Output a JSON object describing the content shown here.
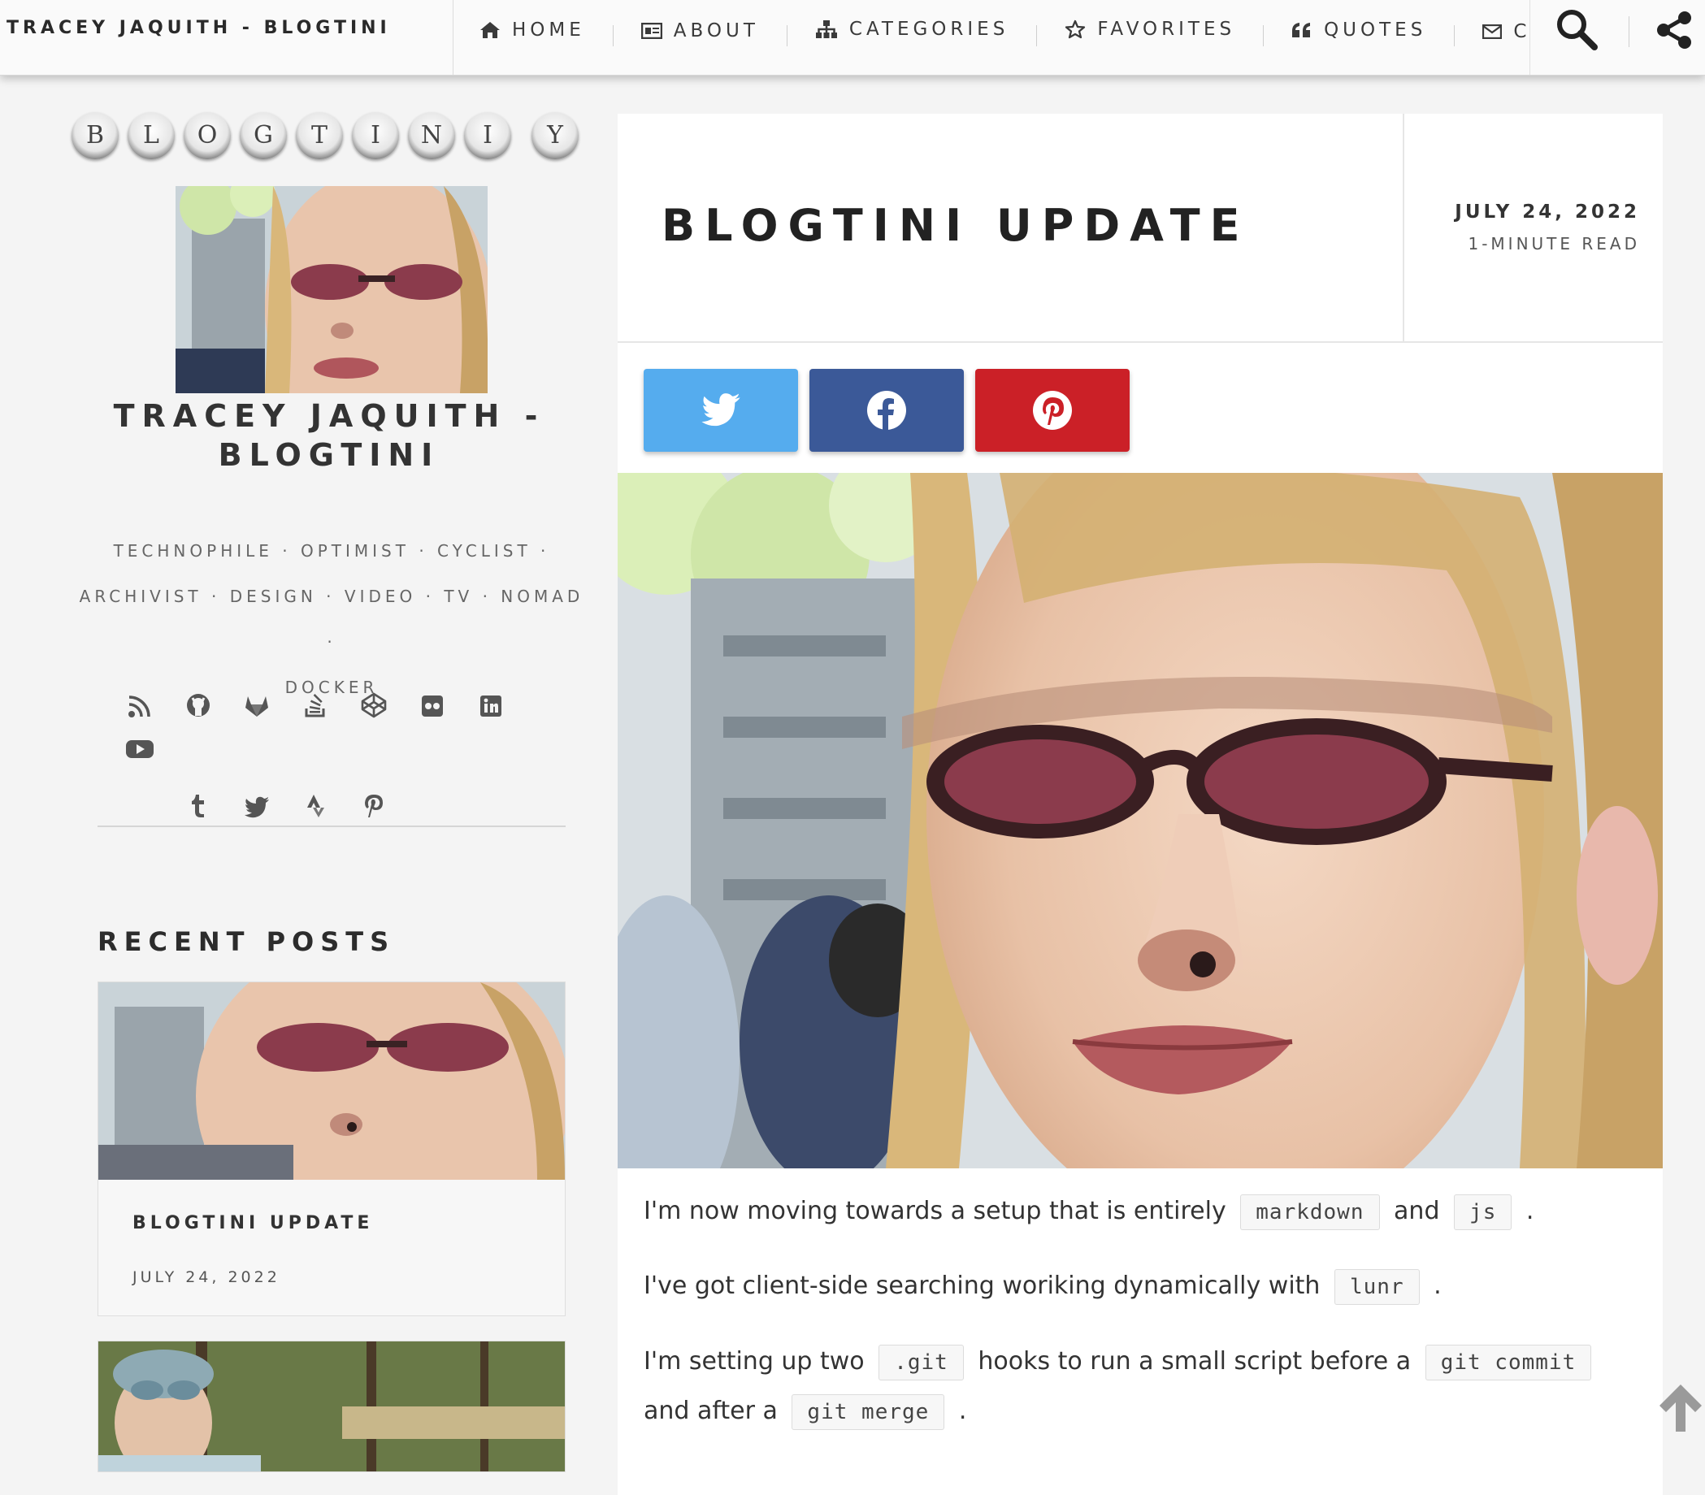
{
  "header": {
    "site_title": "TRACEY JAQUITH - BLOGTINI",
    "nav": [
      {
        "label": "HOME",
        "icon": "home-icon"
      },
      {
        "label": "ABOUT",
        "icon": "id-card-icon"
      },
      {
        "label": "CATEGORIES",
        "icon": "sitemap-icon"
      },
      {
        "label": "FAVORITES",
        "icon": "star-icon"
      },
      {
        "label": "QUOTES",
        "icon": "quote-icon"
      },
      {
        "label": "C",
        "icon": "envelope-icon"
      }
    ],
    "search_icon": "search-icon",
    "share_icon": "share-icon"
  },
  "sidebar": {
    "logo_letters": [
      "B",
      "L",
      "O",
      "G",
      "T",
      "I",
      "N",
      "I",
      "Y"
    ],
    "author_name_line1": "TRACEY JAQUITH -",
    "author_name_line2": "BLOGTINI",
    "bio_line1": "TECHNOPHILE · OPTIMIST · CYCLIST ·",
    "bio_line2": "ARCHIVIST · DESIGN · VIDEO · TV · NOMAD ·",
    "bio_line3": "DOCKER",
    "social_icons": [
      "rss-icon",
      "github-icon",
      "gitlab-icon",
      "stack-overflow-icon",
      "codepen-icon",
      "flickr-icon",
      "linkedin-icon",
      "youtube-icon",
      "tumblr-icon",
      "twitter-icon",
      "strava-icon",
      "pinterest-icon"
    ],
    "recent_posts_title": "RECENT POSTS",
    "recent_posts": [
      {
        "title": "BLOGTINI UPDATE",
        "date": "JULY 24, 2022"
      }
    ]
  },
  "article": {
    "title": "BLOGTINI UPDATE",
    "date": "JULY 24, 2022",
    "read_time": "1-MINUTE READ",
    "share_buttons": [
      "twitter-icon",
      "facebook-icon",
      "pinterest-icon"
    ],
    "share_colors": {
      "twitter": "#55acee",
      "facebook": "#3b5998",
      "pinterest": "#cb2027"
    },
    "p1_a": "I'm now moving towards a setup that is entirely",
    "p1_code1": "markdown",
    "p1_b": "and",
    "p1_code2": "js",
    "p1_c": ".",
    "p2_a": "I've got client-side searching woriking dynamically with",
    "p2_code": "lunr",
    "p2_b": ".",
    "p3_a": "I'm setting up two",
    "p3_code1": ".git",
    "p3_b": "hooks to run a small script before a",
    "p3_code2": "git commit",
    "p3_c": "and after a",
    "p3_code3": "git merge",
    "p3_d": "."
  },
  "back_to_top_icon": "arrow-up-icon"
}
